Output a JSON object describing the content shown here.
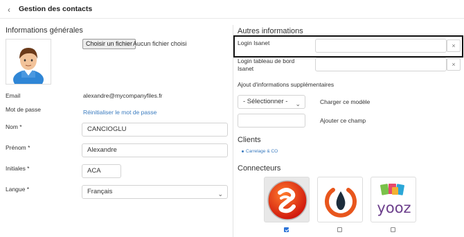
{
  "header": {
    "back_icon": "chevron-left-icon",
    "title": "Gestion des contacts"
  },
  "general": {
    "title": "Informations générales",
    "file_button": "Choisir un fichier",
    "file_status": "Aucun fichier choisi",
    "email_label": "Email",
    "email_value": "alexandre@mycompanyfiles.fr",
    "password_label": "Mot de passe",
    "password_link": "Réinitialiser le mot de passe",
    "nom_label": "Nom *",
    "nom_value": "CANCIOGLU",
    "prenom_label": "Prénom *",
    "prenom_value": "Alexandre",
    "initiales_label": "Initiales *",
    "initiales_value": "ACA",
    "langue_label": "Langue *",
    "langue_value": "Français"
  },
  "other": {
    "title": "Autres informations",
    "login_isanet_label": "Login Isanet",
    "login_isanet_value": "",
    "login_tableau_label_1": "Login tableau de bord",
    "login_tableau_label_2": "Isanet",
    "login_tableau_value": "",
    "clear_symbol": "×",
    "ajout_label": "Ajout d'informations supplémentaires",
    "select_value": "- Sélectionner -",
    "charger_label": "Charger ce modèle",
    "ajouter_label": "Ajouter ce champ",
    "ajouter_value": ""
  },
  "clients": {
    "title": "Clients",
    "items": [
      "Carrelage & CO"
    ]
  },
  "connecteurs": {
    "title": "Connecteurs",
    "items": [
      {
        "icon": "isanet-logo-icon",
        "checked": true
      },
      {
        "icon": "power-drop-logo-icon",
        "checked": false
      },
      {
        "icon": "yooz-logo-icon",
        "label": "yooz",
        "checked": false
      }
    ]
  }
}
